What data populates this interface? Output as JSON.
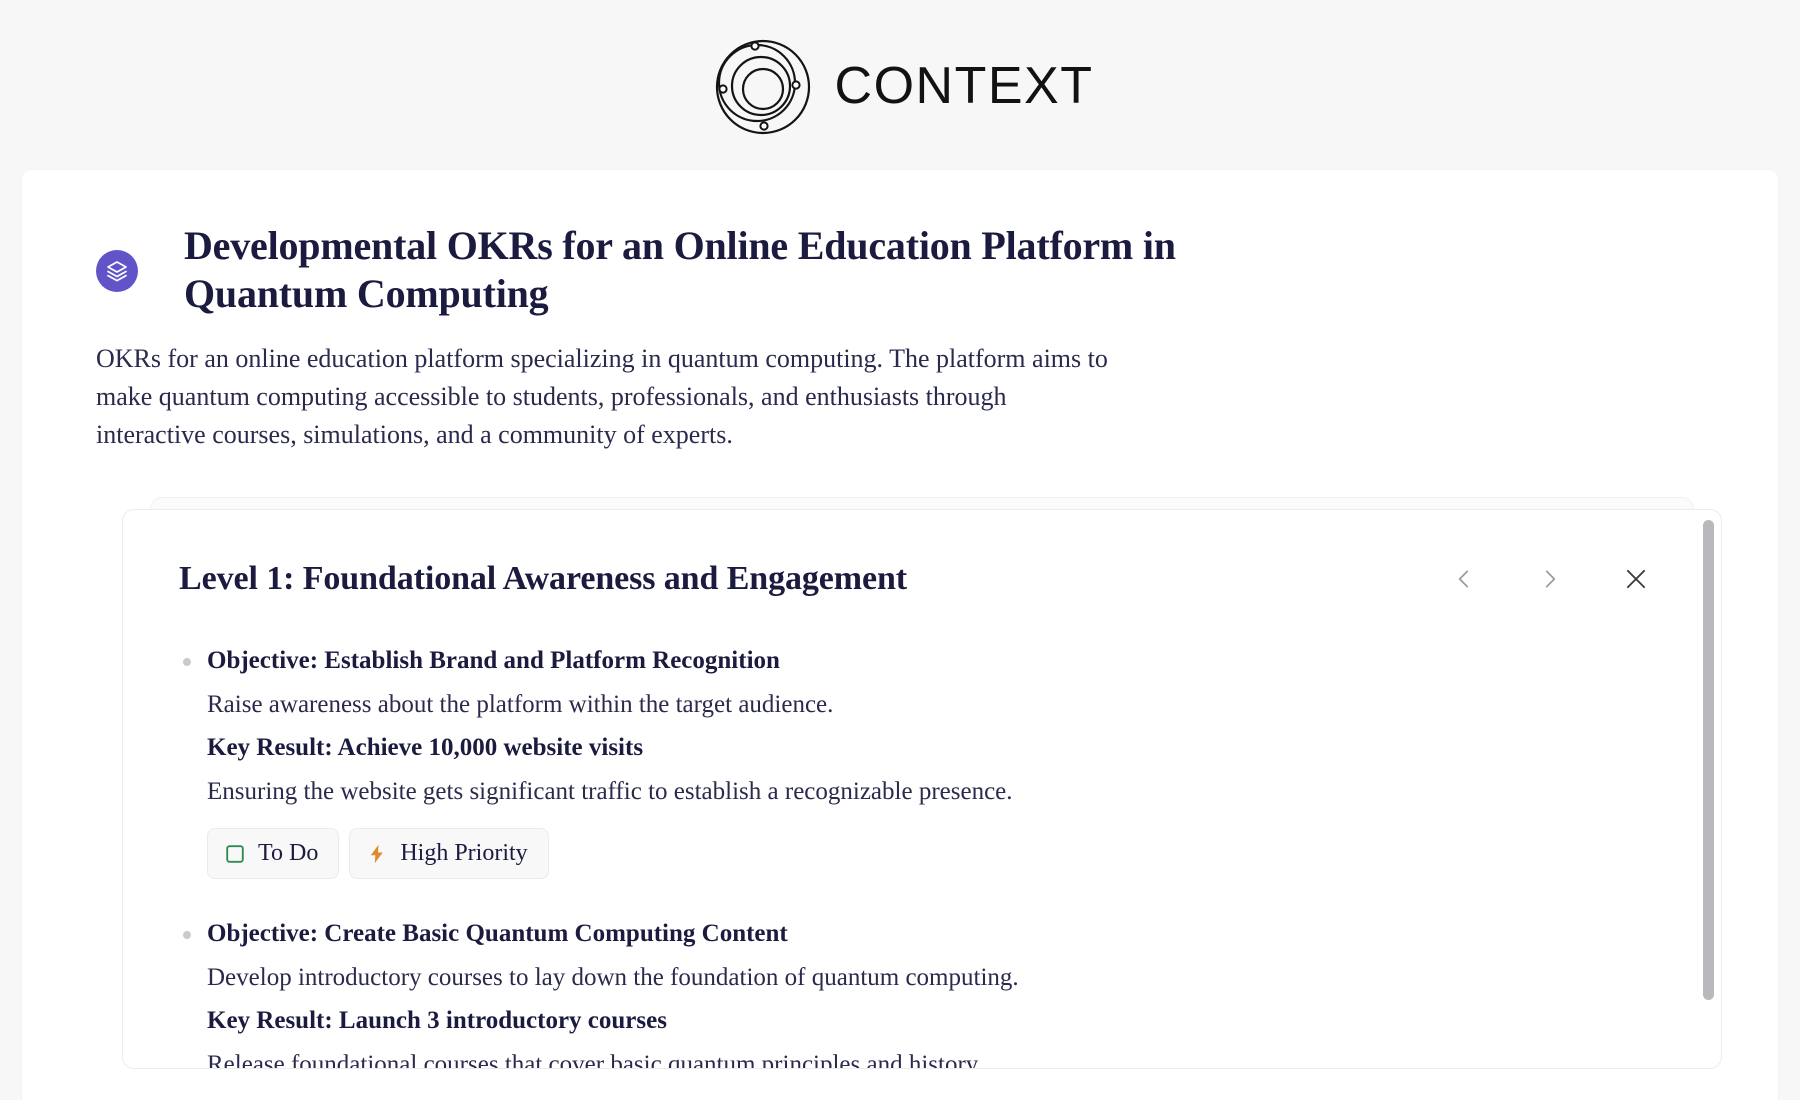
{
  "brand": {
    "wordmark": "CONTEXT",
    "logo_icon": "orbit-circles-logo"
  },
  "document": {
    "icon": "layers-stack-icon",
    "icon_bg_color": "#6154c8",
    "title": "Developmental OKRs for an Online Education Platform in Quantum Computing",
    "description": "OKRs for an online education platform specializing in quantum computing. The platform aims to make quantum computing accessible to students, professionals, and enthusiasts through interactive courses, simulations, and a community of experts."
  },
  "card": {
    "title": "Level 1: Foundational Awareness and Engagement",
    "nav": {
      "prev_icon": "chevron-left-icon",
      "next_icon": "chevron-right-icon",
      "close_icon": "close-icon"
    },
    "items": [
      {
        "objective": "Objective: Establish Brand and Platform Recognition",
        "objective_desc": "Raise awareness about the platform within the target audience.",
        "key_result": "Key Result: Achieve 10,000 website visits",
        "key_result_desc": "Ensuring the website gets significant traffic to establish a recognizable presence.",
        "tags": [
          {
            "label": "To Do",
            "icon": "checkbox-square-icon",
            "color": "#2f8a4e"
          },
          {
            "label": "High Priority",
            "icon": "lightning-bolt-icon",
            "color": "#e08a2e"
          }
        ]
      },
      {
        "objective": "Objective: Create Basic Quantum Computing Content",
        "objective_desc": "Develop introductory courses to lay down the foundation of quantum computing.",
        "key_result": "Key Result: Launch 3 introductory courses",
        "key_result_desc": "Release foundational courses that cover basic quantum principles and history.",
        "tags": []
      }
    ]
  },
  "colors": {
    "page_bg": "#f7f7f8",
    "panel_bg": "#ffffff",
    "heading": "#1b1b40",
    "accent_purple": "#6154c8",
    "scrollbar_thumb": "#b9b9bd"
  }
}
